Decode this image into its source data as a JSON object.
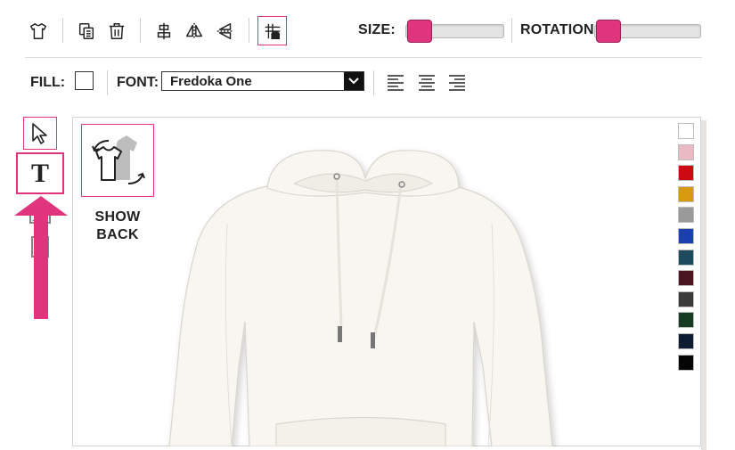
{
  "toolbar": {
    "size_label": "SIZE:",
    "rotation_label": "ROTATION:",
    "size_value": 0.0,
    "rotation_value": 0.0,
    "icons": [
      "shirt-icon",
      "copy-icon",
      "trash-icon",
      "align-center-icon",
      "flip-horizontal-icon",
      "flip-vertical-icon",
      "grid-icon"
    ]
  },
  "format_bar": {
    "fill_label": "FILL:",
    "font_label": "FONT:",
    "font_value": "Fredoka One",
    "fill_color": "#ffffff",
    "align_icons": [
      "align-left-icon",
      "align-center-icon",
      "align-right-icon"
    ]
  },
  "tools": {
    "text_tool_glyph": "T"
  },
  "canvas": {
    "show_back_line1": "SHOW",
    "show_back_line2": "BACK"
  },
  "colors": {
    "accent": "#e0357c",
    "swatches": [
      "#ffffff",
      "#e9b9c4",
      "#cc0a12",
      "#d89a10",
      "#9a9a9a",
      "#1a3fb0",
      "#1d4a5e",
      "#4a1420",
      "#3a3a3a",
      "#153b22",
      "#0e1c33",
      "#050505"
    ]
  }
}
